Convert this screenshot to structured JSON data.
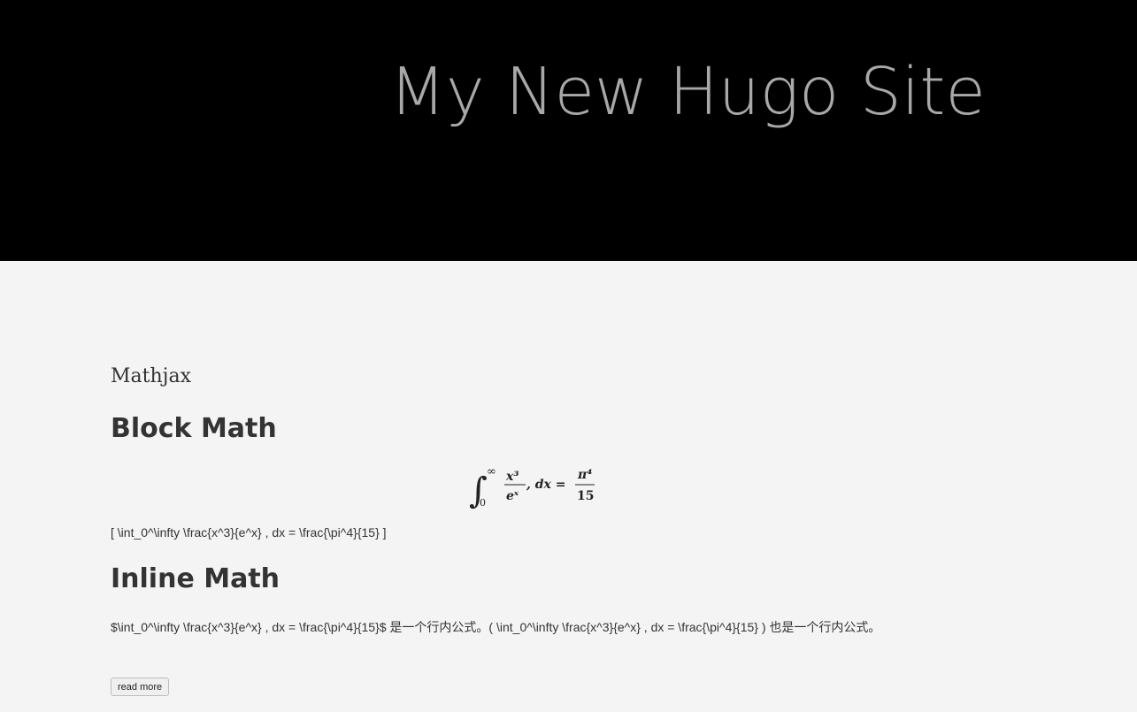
{
  "header": {
    "site_title": "My New Hugo Site",
    "background_color": "#000000",
    "title_color": "#a8a8a8"
  },
  "post": {
    "title": "Mathjax",
    "sections": [
      {
        "heading": "Block Math",
        "rendered_math": {
          "integral_lower": "0",
          "integral_upper": "∞",
          "lhs_numerator": "x³",
          "lhs_denominator": "eˣ",
          "middle": ", dx =",
          "rhs_numerator": "π⁴",
          "rhs_denominator": "15"
        },
        "text": "[ \\int_0^\\infty \\frac{x^3}{e^x} , dx = \\frac{\\pi^4}{15} ]"
      },
      {
        "heading": "Inline Math",
        "text": "$\\int_0^\\infty \\frac{x^3}{e^x} , dx = \\frac{\\pi^4}{15}$ 是一个行内公式。( \\int_0^\\infty \\frac{x^3}{e^x} , dx = \\frac{\\pi^4}{15} ) 也是一个行内公式。"
      }
    ],
    "read_more_label": "read more"
  },
  "page_background": "#f4f4f4",
  "text_color": "#333333"
}
